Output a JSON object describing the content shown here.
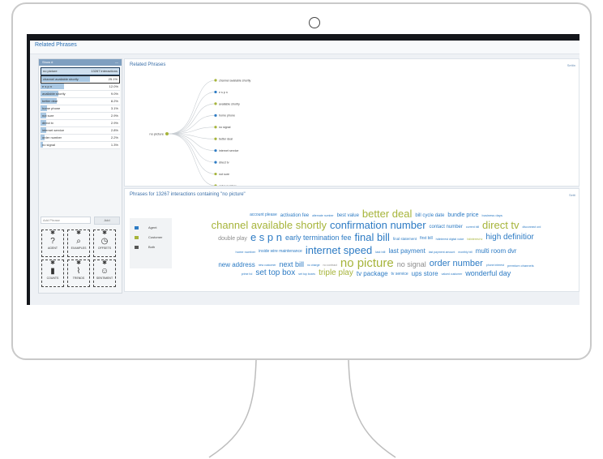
{
  "app": {
    "title": "Related Phrases"
  },
  "left_panel": {
    "header": "Show #",
    "selected": {
      "label": "no picture",
      "count": "13267 interactions"
    },
    "phrases": [
      {
        "label": "channel available shortly",
        "pct": "25.1%",
        "fill": 0.62
      },
      {
        "label": "e s p n",
        "pct": "12.0%",
        "fill": 0.3
      },
      {
        "label": "available shortly",
        "pct": "9.0%",
        "fill": 0.22
      },
      {
        "label": "better deal",
        "pct": "8.2%",
        "fill": 0.2
      },
      {
        "label": "home phone",
        "pct": "3.1%",
        "fill": 0.08
      },
      {
        "label": "not sure",
        "pct": "2.9%",
        "fill": 0.07
      },
      {
        "label": "direct tv",
        "pct": "2.9%",
        "fill": 0.07
      },
      {
        "label": "internet service",
        "pct": "2.8%",
        "fill": 0.07
      },
      {
        "label": "order number",
        "pct": "2.2%",
        "fill": 0.05
      },
      {
        "label": "no signal",
        "pct": "1.3%",
        "fill": 0.03
      }
    ],
    "add_placeholder": "Add Phrase",
    "add_button": "Add",
    "tools": [
      {
        "name": "agent",
        "label": "AGENT",
        "icon": "?"
      },
      {
        "name": "examples",
        "label": "EXAMPLES",
        "icon": "⌕"
      },
      {
        "name": "offsets",
        "label": "OFFSETS",
        "icon": "◷"
      },
      {
        "name": "counts",
        "label": "COUNTS",
        "icon": "▮"
      },
      {
        "name": "trends",
        "label": "TRENDS",
        "icon": "⌇"
      },
      {
        "name": "sentiment",
        "label": "SENTIMENT",
        "icon": "☺"
      }
    ]
  },
  "related": {
    "title": "Related Phrases",
    "settings": "Settin",
    "root": "no picture",
    "nodes": [
      {
        "label": "channel available shortly",
        "color": "#a6b43a"
      },
      {
        "label": "e s p n",
        "color": "#2d7bc4"
      },
      {
        "label": "available shortly",
        "color": "#a6b43a"
      },
      {
        "label": "home phone",
        "color": "#2d7bc4"
      },
      {
        "label": "no signal",
        "color": "#a6b43a"
      },
      {
        "label": "better deal",
        "color": "#a6b43a"
      },
      {
        "label": "internet service",
        "color": "#2d7bc4"
      },
      {
        "label": "direct tv",
        "color": "#2d7bc4"
      },
      {
        "label": "not sure",
        "color": "#a6b43a"
      },
      {
        "label": "order number",
        "color": "#a6b43a"
      }
    ]
  },
  "phrases_panel": {
    "title": "Phrases for 13267 interactions containing \"no picture\"",
    "settings": "Setti",
    "legend": [
      {
        "label": "Agent",
        "color": "#2d7bc4"
      },
      {
        "label": "Customer",
        "color": "#a6b43a"
      },
      {
        "label": "Both",
        "color": "#555555"
      }
    ]
  },
  "cloud_words": [
    {
      "t": "account please",
      "c": "c1",
      "s": 5
    },
    {
      "t": "activation fee",
      "c": "c1",
      "s": 6
    },
    {
      "t": "alternate number",
      "c": "c1",
      "s": 3.5
    },
    {
      "t": "best value",
      "c": "c1",
      "s": 6
    },
    {
      "t": "better deal",
      "c": "c2",
      "s": 13
    },
    {
      "t": "bill cycle date",
      "c": "c1",
      "s": 6
    },
    {
      "t": "bundle price",
      "c": "c1",
      "s": 7
    },
    {
      "t": "business days",
      "c": "c1",
      "s": 4
    },
    {
      "t": "channel available shortly",
      "c": "c2",
      "s": 13
    },
    {
      "t": "confirmation number",
      "c": "c1",
      "s": 13
    },
    {
      "t": "contact number",
      "c": "c1",
      "s": 6
    },
    {
      "t": "current bill",
      "c": "c1",
      "s": 3.5
    },
    {
      "t": "direct tv",
      "c": "c2",
      "s": 13
    },
    {
      "t": "disconnect ord",
      "c": "c1",
      "s": 3.5
    },
    {
      "t": "double play",
      "c": "c3",
      "s": 7
    },
    {
      "t": "e s p n",
      "c": "c1",
      "s": 13
    },
    {
      "t": "early termination fee",
      "c": "c1",
      "s": 9
    },
    {
      "t": "final bill",
      "c": "c1",
      "s": 13
    },
    {
      "t": "final statement",
      "c": "c1",
      "s": 4.5
    },
    {
      "t": "first bill",
      "c": "c1",
      "s": 5
    },
    {
      "t": "hdinterest digital voice",
      "c": "c1",
      "s": 3.5
    },
    {
      "t": "hdinterest tv",
      "c": "c2",
      "s": 3.5
    },
    {
      "t": "high definitior",
      "c": "c1",
      "s": 10
    },
    {
      "t": "home number",
      "c": "c1",
      "s": 4
    },
    {
      "t": "inside wire maintenance",
      "c": "c1",
      "s": 5
    },
    {
      "t": "internet speed",
      "c": "c1",
      "s": 13
    },
    {
      "t": "last bill",
      "c": "c1",
      "s": 4
    },
    {
      "t": "last payment",
      "c": "c1",
      "s": 8
    },
    {
      "t": "last payment amount",
      "c": "c1",
      "s": 3.5
    },
    {
      "t": "monthly bill",
      "c": "c1",
      "s": 3.5
    },
    {
      "t": "multi room dvr",
      "c": "c1",
      "s": 8
    },
    {
      "t": "new address",
      "c": "c1",
      "s": 8
    },
    {
      "t": "new customer",
      "c": "c1",
      "s": 3.5
    },
    {
      "t": "next bill",
      "c": "c1",
      "s": 9
    },
    {
      "t": "no charge",
      "c": "c1",
      "s": 3.5
    },
    {
      "t": "no contract",
      "c": "c3",
      "s": 3.5
    },
    {
      "t": "no picture",
      "c": "c2",
      "s": 15
    },
    {
      "t": "no signal",
      "c": "c3",
      "s": 9
    },
    {
      "t": "order number",
      "c": "c1",
      "s": 11
    },
    {
      "t": "phone interest",
      "c": "c1",
      "s": 3.5
    },
    {
      "t": "premium channels",
      "c": "c1",
      "s": 4
    },
    {
      "t": "prime hd",
      "c": "c1",
      "s": 3.5
    },
    {
      "t": "set top box",
      "c": "c1",
      "s": 10
    },
    {
      "t": "set top boxes",
      "c": "c1",
      "s": 3.5
    },
    {
      "t": "triple play",
      "c": "c2",
      "s": 10
    },
    {
      "t": "tv package",
      "c": "c1",
      "s": 8
    },
    {
      "t": "tv service",
      "c": "c1",
      "s": 5
    },
    {
      "t": "ups store",
      "c": "c1",
      "s": 8
    },
    {
      "t": "valued customer",
      "c": "c1",
      "s": 3.5
    },
    {
      "t": "wonderful day",
      "c": "c1",
      "s": 9
    }
  ]
}
